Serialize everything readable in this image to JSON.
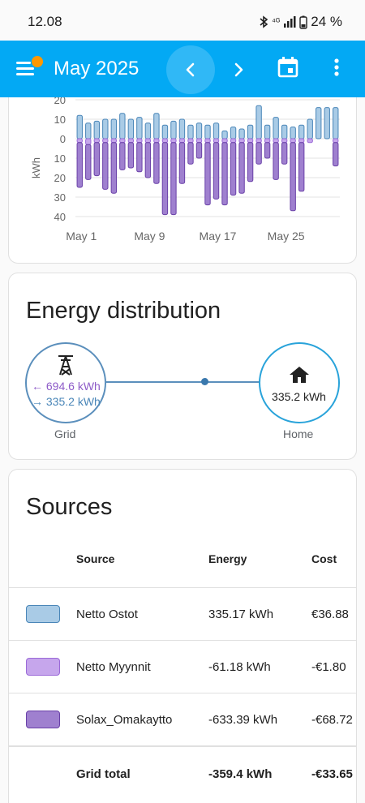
{
  "status_bar": {
    "time": "12.08",
    "network": "⁴ᴳ",
    "battery": "24 %"
  },
  "app_bar": {
    "title": "May 2025",
    "menu_icon": "hamburger-menu-icon",
    "prev_icon": "chevron-left-icon",
    "next_icon": "chevron-right-icon",
    "calendar_icon": "calendar-icon",
    "more_icon": "more-vertical-icon",
    "accent": "#03a9f4",
    "badge_color": "#ff9800"
  },
  "chart_data": {
    "type": "bar",
    "ylabel": "kWh",
    "y_ticks": [
      "20",
      "10",
      "0",
      "10",
      "20",
      "30",
      "40"
    ],
    "x_ticks": [
      "May 1",
      "May 9",
      "May 17",
      "May 25"
    ],
    "ylim": [
      -40,
      20
    ],
    "grid": true,
    "x": [
      1,
      2,
      3,
      4,
      5,
      6,
      7,
      8,
      9,
      10,
      11,
      12,
      13,
      14,
      15,
      16,
      17,
      18,
      19,
      20,
      21,
      22,
      23,
      24,
      25,
      26,
      27,
      28,
      29,
      30,
      31
    ],
    "series": [
      {
        "color": "#a9cbe6",
        "stroke": "#4a86b8",
        "values": [
          12,
          8,
          9,
          10,
          10,
          13,
          10,
          11,
          8,
          13,
          7,
          9,
          10,
          7,
          8,
          7,
          8,
          4,
          6,
          5,
          7,
          17,
          7,
          11,
          7,
          6,
          7,
          10,
          16,
          16,
          16
        ]
      },
      {
        "color": "#c6a6ec",
        "stroke": "#9b6ad8",
        "values": [
          -2,
          -3,
          -2,
          -2,
          -2,
          -2,
          -2,
          -2,
          -2,
          -2,
          -2,
          -2,
          -2,
          -2,
          -2,
          -2,
          -2,
          -2,
          -2,
          -2,
          -2,
          -2,
          -2,
          -2,
          -2,
          -2,
          -2,
          -2,
          0,
          0,
          -2
        ]
      },
      {
        "color": "#9f80cf",
        "stroke": "#6a41a8",
        "values": [
          -23,
          -18,
          -17,
          -24,
          -26,
          -14,
          -13,
          -15,
          -18,
          -21,
          -37,
          -37,
          -21,
          -11,
          -8,
          -32,
          -29,
          -32,
          -27,
          -26,
          -20,
          -11,
          -8,
          -19,
          -11,
          -35,
          -25,
          0,
          0,
          0,
          -12
        ]
      }
    ]
  },
  "energy_distribution": {
    "title": "Energy distribution",
    "grid": {
      "label": "Grid",
      "icon": "transmission-tower-icon",
      "import_value": "← 694.6 kWh",
      "export_value": "→ 335.2 kWh"
    },
    "home": {
      "label": "Home",
      "icon": "home-icon",
      "value": "335.2 kWh"
    }
  },
  "sources": {
    "title": "Sources",
    "headers": {
      "source": "Source",
      "energy": "Energy",
      "cost": "Cost"
    },
    "rows": [
      {
        "name": "Netto Ostot",
        "energy": "335.17 kWh",
        "cost": "€36.88",
        "color": "#a9cbe6",
        "stroke": "#4a86b8"
      },
      {
        "name": "Netto Myynnit",
        "energy": "-61.18 kWh",
        "cost": "-€1.80",
        "color": "#c6a6ec",
        "stroke": "#9b6ad8"
      },
      {
        "name": "Solax_Omakaytto",
        "energy": "-633.39 kWh",
        "cost": "-€68.72",
        "color": "#9f80cf",
        "stroke": "#6a41a8"
      }
    ],
    "total": {
      "label": "Grid total",
      "energy": "-359.4 kWh",
      "cost": "-€33.65"
    }
  }
}
